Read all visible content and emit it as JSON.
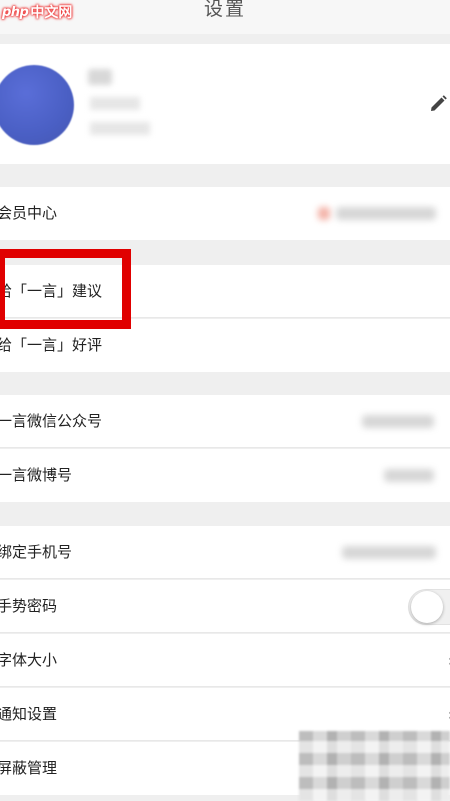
{
  "watermark": {
    "logo_prefix": "php",
    "logo_suffix": "中文网"
  },
  "header": {
    "title": "设置"
  },
  "profile": {
    "edit_icon": "pencil-icon"
  },
  "sections": {
    "membership": {
      "label": "会员中心"
    },
    "feedback": [
      {
        "label": "给「一言」建议"
      },
      {
        "label": "给「一言」好评"
      }
    ],
    "social": [
      {
        "label": "一言微信公众号"
      },
      {
        "label": "一言微博号"
      }
    ],
    "settings": [
      {
        "label": "绑定手机号"
      },
      {
        "label": "手势密码",
        "toggle_on": false
      },
      {
        "label": "字体大小"
      },
      {
        "label": "通知设置"
      },
      {
        "label": "屏蔽管理"
      }
    ]
  },
  "colors": {
    "highlight_border": "#e00000",
    "background": "#efefef",
    "row_bg": "#ffffff"
  }
}
